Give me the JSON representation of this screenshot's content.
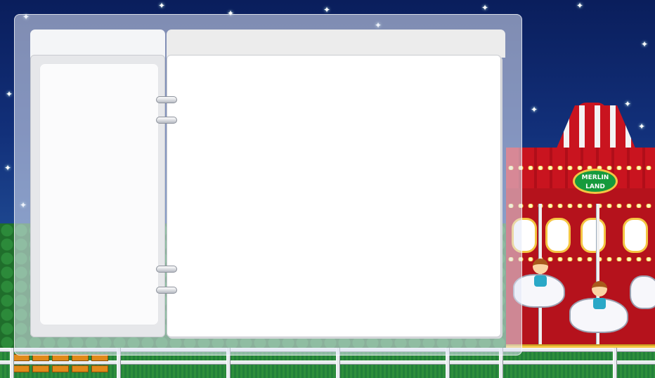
{
  "scene": {
    "sign_line1": "MERLIN",
    "sign_line2": "LAND"
  },
  "binder": {
    "left_title": "",
    "right_title": "",
    "ring_count": 4
  },
  "colors": {
    "sky_top": "#0a1e5c",
    "carousel_red": "#b5121c",
    "accent_gold": "#f4c542",
    "panel_white": "#ffffff"
  },
  "icons": [
    "star-icon",
    "binder-ring-icon"
  ]
}
